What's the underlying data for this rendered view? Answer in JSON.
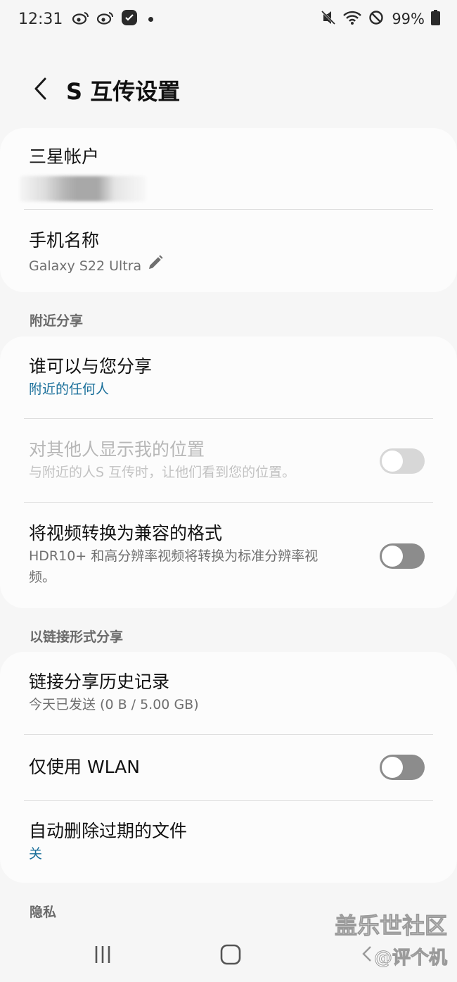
{
  "status_bar": {
    "time": "12:31",
    "battery": "99%",
    "icons": [
      "weibo-icon",
      "weibo-icon",
      "app-notification-icon",
      "notification-dot",
      "vibrate-off-icon",
      "wifi-icon",
      "do-not-disturb-icon",
      "battery-icon"
    ]
  },
  "header": {
    "back_icon": "chevron-left-icon",
    "title": "S 互传设置"
  },
  "account_card": {
    "account_label": "三星帐户",
    "device_name_label": "手机名称",
    "device_name_value": "Galaxy S22 Ultra",
    "edit_icon": "pencil-icon"
  },
  "nearby": {
    "section_label": "附近分享",
    "who_can_share_label": "谁可以与您分享",
    "who_can_share_value": "附近的任何人",
    "show_location_label": "对其他人显示我的位置",
    "show_location_desc": "与附近的人S 互传时，让他们看到您的位置。",
    "show_location_on": false,
    "convert_video_label": "将视频转换为兼容的格式",
    "convert_video_desc": "HDR10+ 和高分辨率视频将转换为标准分辨率视频。",
    "convert_video_on": false
  },
  "link_share": {
    "section_label": "以链接形式分享",
    "history_label": "链接分享历史记录",
    "history_value": "今天已发送 (0 B / 5.00 GB)",
    "wlan_only_label": "仅使用 WLAN",
    "wlan_only_on": false,
    "auto_delete_label": "自动删除过期的文件",
    "auto_delete_value": "关"
  },
  "privacy": {
    "section_label": "隐私"
  },
  "nav_bar": {
    "icons": [
      "recents-icon",
      "home-icon"
    ]
  },
  "watermark": {
    "line1": "盖乐世社区",
    "line2": "@评个机"
  },
  "colors": {
    "background": "#f6f6f6",
    "card": "#fcfcfc",
    "accent_blue": "#1a6f9a",
    "toggle_off": "#8c8c8c"
  }
}
